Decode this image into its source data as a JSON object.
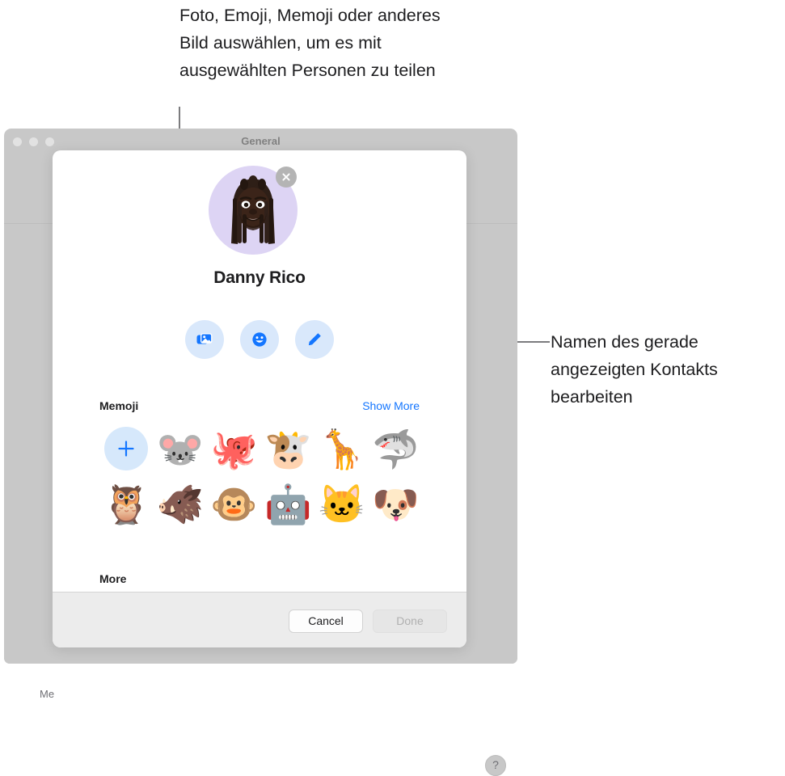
{
  "callouts": {
    "left": "Foto, Emoji, Memoji oder anderes Bild auswählen, um es mit ausgewählten Personen zu teilen",
    "right": "Namen des gerade angezeigten Kontakts bearbeiten"
  },
  "window": {
    "title": "General",
    "me_label": "Me",
    "help_label": "?",
    "traffic_lights": [
      "close-dot",
      "minimize-dot",
      "zoom-dot"
    ]
  },
  "dialog": {
    "avatar": {
      "icon": "memoji-avatar-dreadlocks",
      "background_color": "#ddd4f4",
      "close_icon": "close-icon"
    },
    "contact_name": "Danny Rico",
    "actions": [
      {
        "name": "choose-photo-button",
        "icon": "photos-icon",
        "label": "Foto"
      },
      {
        "name": "choose-emoji-button",
        "icon": "smiley-icon",
        "label": "Emoji"
      },
      {
        "name": "edit-name-button",
        "icon": "pencil-icon",
        "label": "Bearbeiten"
      }
    ],
    "memoji_section": {
      "title": "Memoji",
      "show_more": "Show More",
      "rows": [
        [
          {
            "type": "add",
            "icon": "plus-icon",
            "label": "New Memoji"
          },
          {
            "type": "emoji",
            "glyph": "🐭",
            "label": "mouse"
          },
          {
            "type": "emoji",
            "glyph": "🐙",
            "label": "octopus"
          },
          {
            "type": "emoji",
            "glyph": "🐮",
            "label": "cow"
          },
          {
            "type": "emoji",
            "glyph": "🦒",
            "label": "giraffe"
          },
          {
            "type": "emoji",
            "glyph": "🦈",
            "label": "shark"
          }
        ],
        [
          {
            "type": "emoji",
            "glyph": "🦉",
            "label": "owl"
          },
          {
            "type": "emoji",
            "glyph": "🐗",
            "label": "boar"
          },
          {
            "type": "emoji",
            "glyph": "🐵",
            "label": "monkey"
          },
          {
            "type": "emoji",
            "glyph": "🤖",
            "label": "robot"
          },
          {
            "type": "emoji",
            "glyph": "🐱",
            "label": "cat"
          },
          {
            "type": "emoji",
            "glyph": "🐶",
            "label": "dog"
          }
        ]
      ]
    },
    "more_title": "More",
    "footer": {
      "cancel_label": "Cancel",
      "done_label": "Done",
      "done_enabled": false
    }
  },
  "colors": {
    "accent_blue": "#1476ff",
    "action_button_bg": "#d9e8fb",
    "avatar_bg": "#ddd4f4",
    "window_bg": "#c8c8c8",
    "footer_bg": "#ececec",
    "leader_line": "#7c7c7e"
  }
}
